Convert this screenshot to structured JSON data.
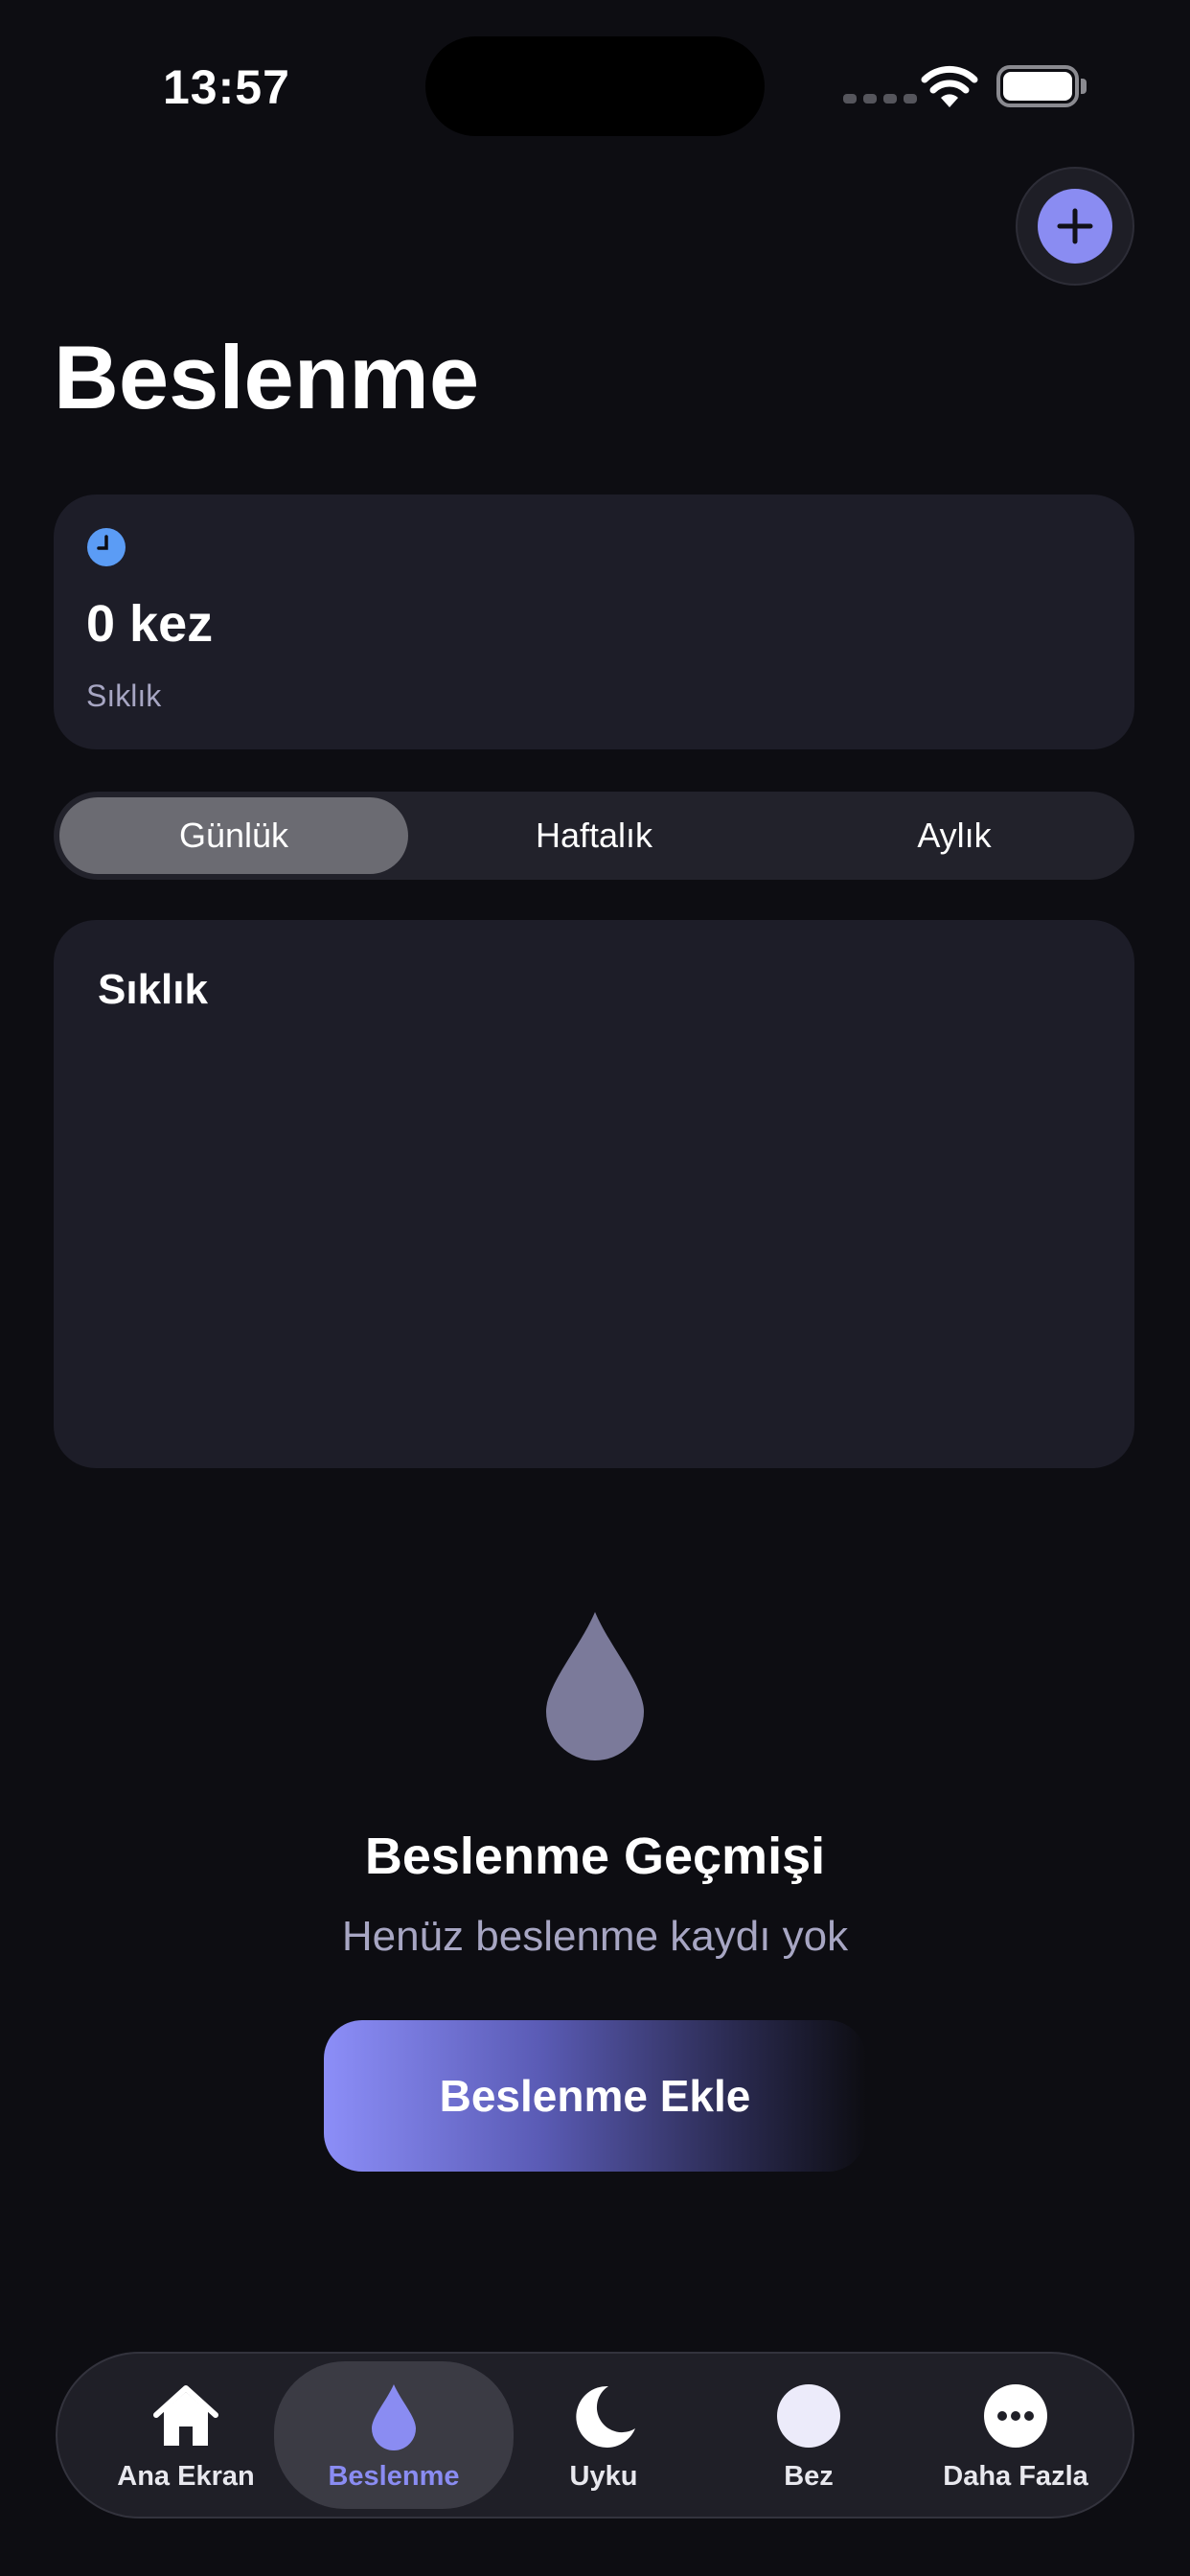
{
  "status_bar": {
    "time": "13:57"
  },
  "header": {
    "title": "Beslenme",
    "add_button_label": "+"
  },
  "stat_card": {
    "value": "0 kez",
    "label": "Sıklık"
  },
  "segments": [
    {
      "label": "Günlük",
      "selected": true
    },
    {
      "label": "Haftalık",
      "selected": false
    },
    {
      "label": "Aylık",
      "selected": false
    }
  ],
  "chart_card": {
    "title": "Sıklık"
  },
  "empty_state": {
    "title": "Beslenme Geçmişi",
    "subtitle": "Henüz beslenme kaydı yok",
    "button_label": "Beslenme Ekle"
  },
  "tab_bar": [
    {
      "label": "Ana Ekran",
      "icon": "house-icon",
      "selected": false
    },
    {
      "label": "Beslenme",
      "icon": "drop-icon",
      "selected": true
    },
    {
      "label": "Uyku",
      "icon": "moon-icon",
      "selected": false
    },
    {
      "label": "Bez",
      "icon": "circle-icon",
      "selected": false
    },
    {
      "label": "Daha Fazla",
      "icon": "more-icon",
      "selected": false
    }
  ],
  "colors": {
    "background": "#0d0d12",
    "card": "#1d1d28",
    "accent": "#8a8cf2",
    "clock_blue": "#5b9cf5",
    "muted_text": "#a7a6c3"
  }
}
